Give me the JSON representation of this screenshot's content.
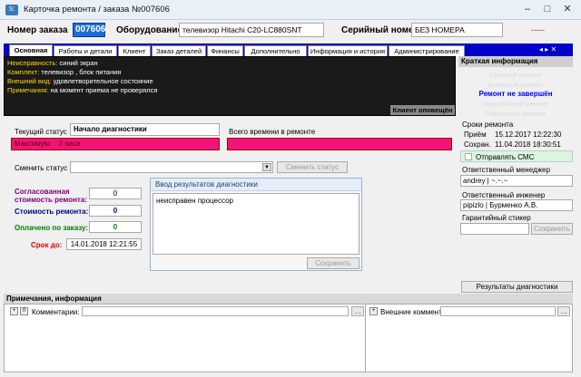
{
  "window": {
    "title": "Карточка ремонта / заказа №007606",
    "icon_label": "S:"
  },
  "header": {
    "order_label": "Номер заказа",
    "order_value": "007606",
    "equipment_label": "Оборудование",
    "equipment_value": "телевизор Hitachi C20-LC880SNT",
    "serial_label": "Серийный номер",
    "serial_value": "БЕЗ НОМЕРА",
    "dashes": "-----"
  },
  "tabs": [
    {
      "label": "Основная"
    },
    {
      "label": "Работы и детали"
    },
    {
      "label": "Клиент"
    },
    {
      "label": "Заказ деталей"
    },
    {
      "label": "Финансы"
    },
    {
      "label": "Дополнительно"
    },
    {
      "label": "Информация и история"
    },
    {
      "label": "Администрирование"
    }
  ],
  "info_panel": {
    "lines": [
      {
        "key": "Неисправность:",
        "value": "синий экран"
      },
      {
        "key": "Комплект:",
        "value": "телевизор , блок питания"
      },
      {
        "key": "Внешний вид:",
        "value": "удовлетворительное состояние"
      },
      {
        "key": "Примечания:",
        "value": "на момент приема не проверялся"
      }
    ],
    "notifier_button": "Клиент оповещён"
  },
  "status": {
    "current_label": "Текущий статус",
    "current_value": "Начало диагностики",
    "max_label": "Максимум:",
    "max_value": "2 часа",
    "total_time_label": "Всего времени в ремонте",
    "change_label": "Сменить статус",
    "change_button": "Сменить статус"
  },
  "money": {
    "agreed_label_1": "Согласованная",
    "agreed_label_2": "стоимость ремонта:",
    "agreed_value": "0",
    "cost_label": "Стоимость ремонта:",
    "cost_value": "0",
    "paid_label": "Оплачено по заказу:",
    "paid_value": "0",
    "deadline_label": "Срок до:",
    "deadline_value": "14.01.2018 12:21:55"
  },
  "diagnostics": {
    "panel_title": "Ввод результатов диагностики",
    "text": "неисправен процессор",
    "save_button": "Сохранить",
    "results_button": "Результаты диагностики"
  },
  "right_panel": {
    "title": "Краткая информация",
    "ghost_lines": [
      "Срочный ремонт",
      "Активный ремонт"
    ],
    "not_finished": "Ремонт не завершён",
    "ghost_lines_2": [
      "Гарантийный ремонт",
      "Повторный ремонт"
    ],
    "terms_label": "Сроки ремонта",
    "received_label": "Приём",
    "received_value": "15.12.2017 12:22:30",
    "saved_label": "Сохран.",
    "saved_value": "11.04.2018 18:30:51",
    "sms_label": "Отправлять СМС",
    "manager_label": "Ответственный менеджер",
    "manager_value": "andrey | ~.~.~",
    "engineer_label": "Ответственный инженер",
    "engineer_value": "pipizlo | Бурменко А.В.",
    "sticker_label": "Гарантийный стикер",
    "sticker_save": "Сохранить"
  },
  "notes": {
    "section_title": "Примечания, информация",
    "comments_label": "Комментарии:",
    "external_label": "Внешние коммент:"
  },
  "colors": {
    "tab_bar": "#0000c8",
    "pink": "#f0137a",
    "order_highlight": "#1a6fd6",
    "not_finished": "#0000ff"
  }
}
